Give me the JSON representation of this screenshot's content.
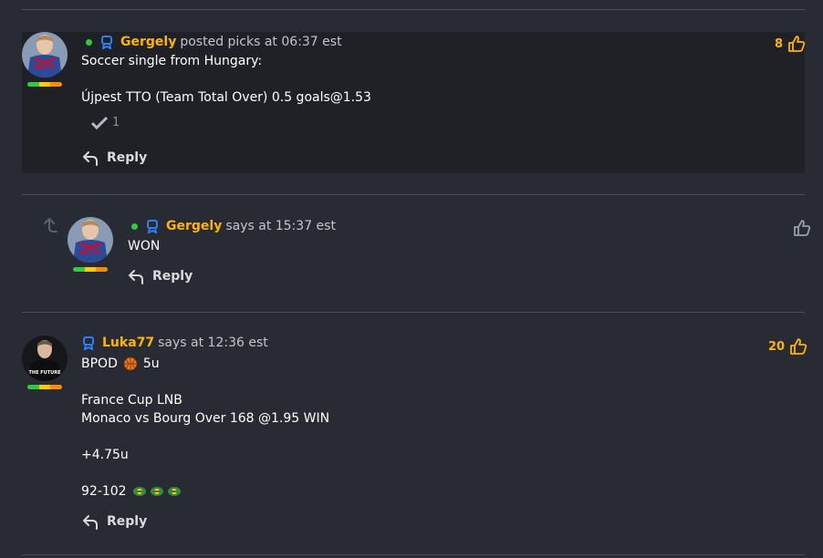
{
  "colors": {
    "accent": "#ffb400",
    "online": "#2ecc40",
    "badge": "#2e7df7",
    "background": "#282b33",
    "highlight": "#1f2126"
  },
  "comments": [
    {
      "username": "Gergely",
      "action": "posted picks at 06:37 est",
      "online": true,
      "lines": [
        "Soccer single from Hungary:",
        "",
        "Újpest TTO (Team Total Over) 0.5 goals@1.53"
      ],
      "confirm_count": "1",
      "likes": "8",
      "reply_label": "Reply",
      "avatar_text": "NETS"
    },
    {
      "username": "Gergely",
      "action": "says at 15:37 est",
      "online": true,
      "lines": [
        "WON"
      ],
      "likes": "",
      "reply_label": "Reply",
      "avatar_text": "NETS"
    },
    {
      "username": "Luka77",
      "action": "says at 12:36 est",
      "online": false,
      "lines": [
        "BPOD",
        "",
        "France Cup LNB",
        "Monaco vs Bourg Over 168 @1.95 WIN",
        "",
        "+4.75u",
        "",
        "92-102"
      ],
      "bpod_units": "5u",
      "likes": "20",
      "reply_label": "Reply",
      "avatar_text": "THE FUTURE"
    }
  ]
}
